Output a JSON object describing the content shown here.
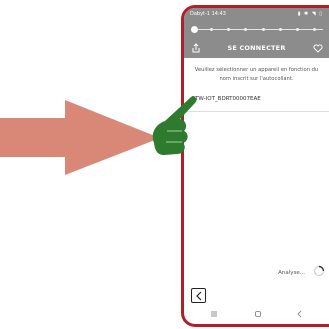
{
  "phone": {
    "status_bar": {
      "left": "Dabyt-1 14:43",
      "right": "▮ ✱ ◥ ▯"
    },
    "progress": {
      "current_step": 1,
      "total_steps": 8
    },
    "header": {
      "title": "SE CONNECTER"
    },
    "instructions": "Veuillez sélectionner un appareil en fonction du nom inscrit sur l'autocollant.",
    "devices": [
      {
        "name": "GTW-IOT_BDRT00007EAE"
      }
    ],
    "analysis_label": "Analyse...",
    "icons": {
      "share": "share-icon",
      "heart": "heart-icon",
      "spinner": "spinner-icon",
      "back": "chevron-left-icon",
      "nav_recent": "recent-apps-icon",
      "nav_home": "home-icon",
      "nav_back": "nav-back-icon"
    }
  },
  "overlay": {
    "arrow_color": "#d98878",
    "hand_color": "#2e7a2e",
    "phone_frame_color": "#b31f26",
    "header_color": "#8c8c8c"
  }
}
